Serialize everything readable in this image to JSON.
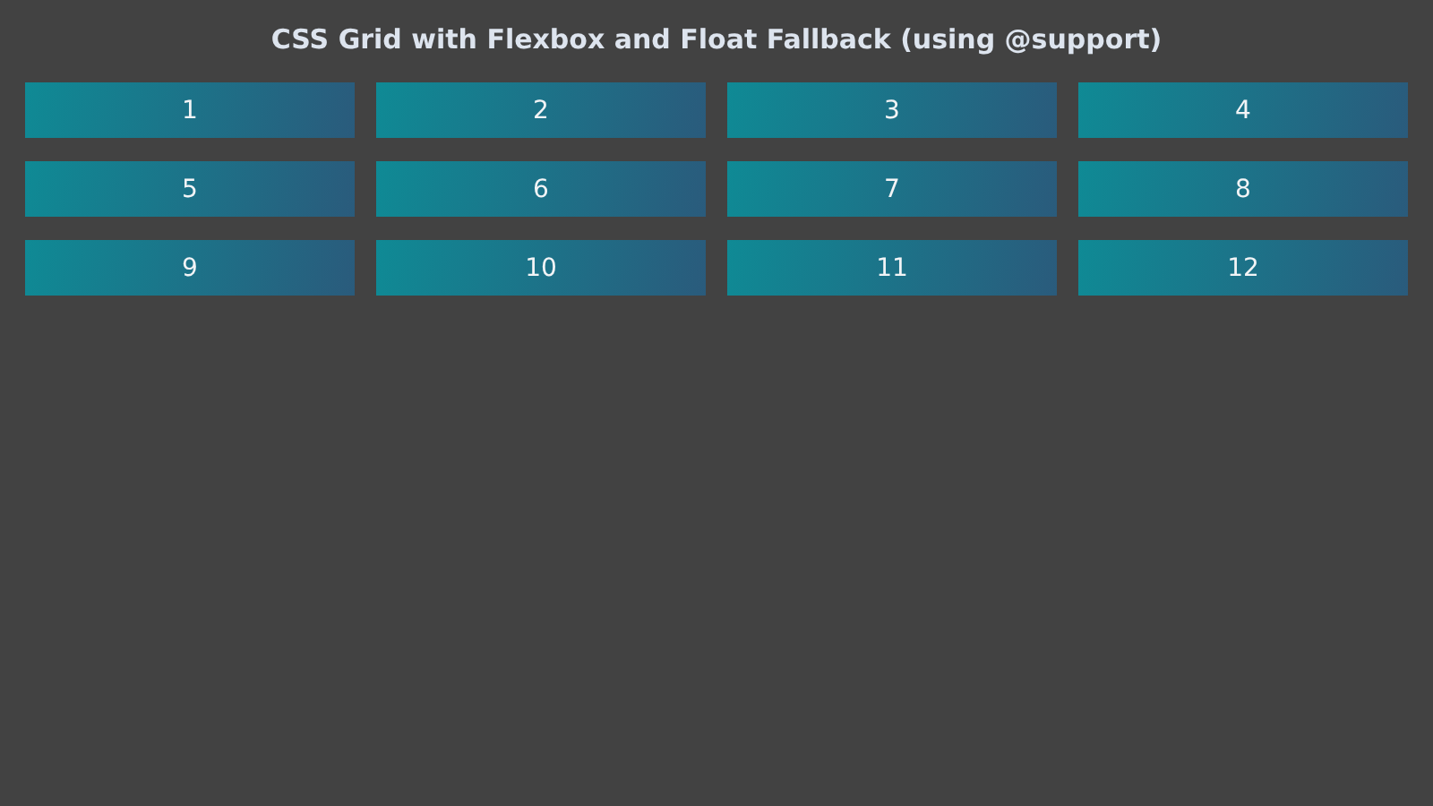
{
  "title": "CSS Grid with Flexbox and Float Fallback (using @support)",
  "cells": [
    "1",
    "2",
    "3",
    "4",
    "5",
    "6",
    "7",
    "8",
    "9",
    "10",
    "11",
    "12"
  ]
}
